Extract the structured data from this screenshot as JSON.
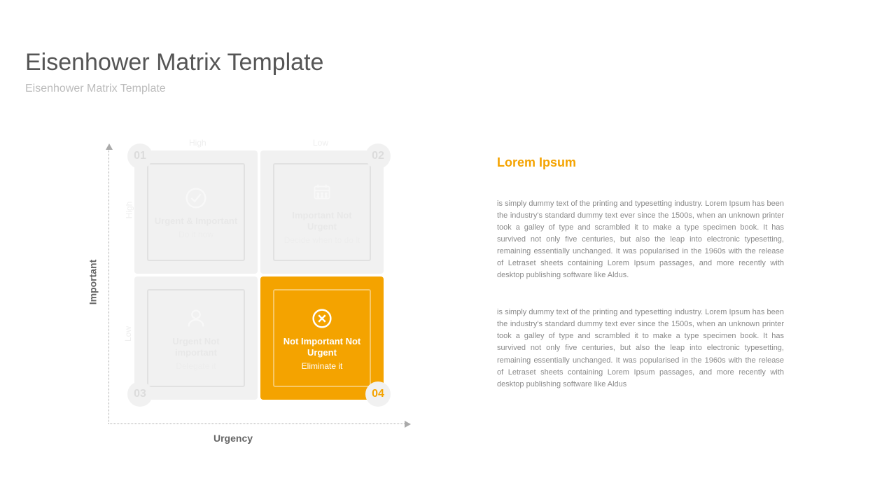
{
  "title": "Eisenhower Matrix Template",
  "subtitle": "Eisenhower Matrix Template",
  "axes": {
    "y": "Important",
    "x": "Urgency",
    "ticks": {
      "high": "High",
      "low": "Low"
    }
  },
  "quadrants": {
    "q1": {
      "num": "01",
      "title": "Urgent & Important",
      "sub": "Do it now"
    },
    "q2": {
      "num": "02",
      "title": "Important Not Urgent",
      "sub": "Decide when to do it"
    },
    "q3": {
      "num": "03",
      "title": "Urgent Not important",
      "sub": "Delegate it"
    },
    "q4": {
      "num": "04",
      "title": "Not Important Not Urgent",
      "sub": "Eliminate it"
    }
  },
  "right": {
    "heading": "Lorem Ipsum",
    "para1": "is simply dummy text of the printing and typesetting industry. Lorem Ipsum has been the industry's standard dummy text ever since the 1500s, when an unknown printer took a galley of type and scrambled it to make a type specimen book. It has survived not only five centuries, but also the leap into electronic typesetting, remaining essentially unchanged. It was popularised in the 1960s with the release of Letraset sheets containing Lorem Ipsum passages, and more recently with desktop publishing software like Aldus.",
    "para2": "is simply dummy text of the printing and typesetting industry. Lorem Ipsum has been the industry's standard dummy text ever since the 1500s, when an unknown printer took a galley of type and scrambled it to make a type specimen book. It has survived not only five centuries, but also the leap into electronic typesetting, remaining essentially unchanged. It was popularised in the 1960s with the release of Letraset sheets containing Lorem Ipsum passages, and more recently with desktop publishing software like Aldus"
  }
}
